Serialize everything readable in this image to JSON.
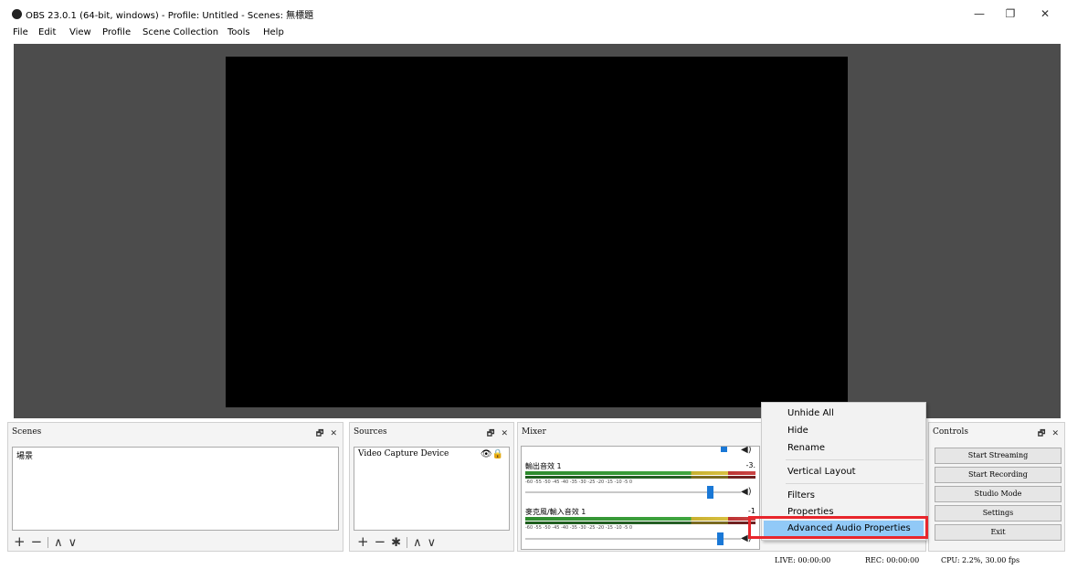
{
  "window": {
    "title": "OBS 23.0.1 (64-bit, windows) - Profile: Untitled - Scenes: 無標題",
    "minimize_icon": "—",
    "maximize_icon": "❐",
    "close_icon": "✕"
  },
  "menu": [
    "File",
    "Edit",
    "View",
    "Profile",
    "Scene Collection",
    "Tools",
    "Help"
  ],
  "docks": {
    "scenes": {
      "title": "Scenes",
      "items": [
        "場景"
      ]
    },
    "sources": {
      "title": "Sources",
      "items": [
        "Video Capture Device"
      ]
    },
    "mixer": {
      "title": "Mixer",
      "tracks": [
        {
          "name": "輸出音效 1",
          "db": "-3.",
          "volume": 0.9
        },
        {
          "name": "麥克風/輸入音效 1",
          "db": "-1",
          "volume": 0.92
        }
      ],
      "scale": "-60  -55  -50  -45  -40  -35  -30  -25  -20  -15  -10  -5  0"
    },
    "controls": {
      "title": "Controls",
      "buttons": [
        "Start Streaming",
        "Start Recording",
        "Studio Mode",
        "Settings",
        "Exit"
      ]
    },
    "header_icons": "🗗 ✕"
  },
  "tool_icons": {
    "add": "+",
    "remove": "−",
    "up": "∧",
    "down": "∨",
    "gear": "✱"
  },
  "context_menu": {
    "items": [
      "Unhide All",
      "Hide",
      "Rename",
      "Vertical Layout",
      "Filters",
      "Properties",
      "Advanced Audio Properties"
    ],
    "highlighted": "Advanced Audio Properties"
  },
  "status": {
    "live": "LIVE: 00:00:00",
    "rec": "REC: 00:00:00",
    "cpu": "CPU: 2.2%, 30.00 fps"
  },
  "colors": {
    "accent": "#1a78d6",
    "highlight": "#91c9f7",
    "annotation": "#e8262c"
  }
}
